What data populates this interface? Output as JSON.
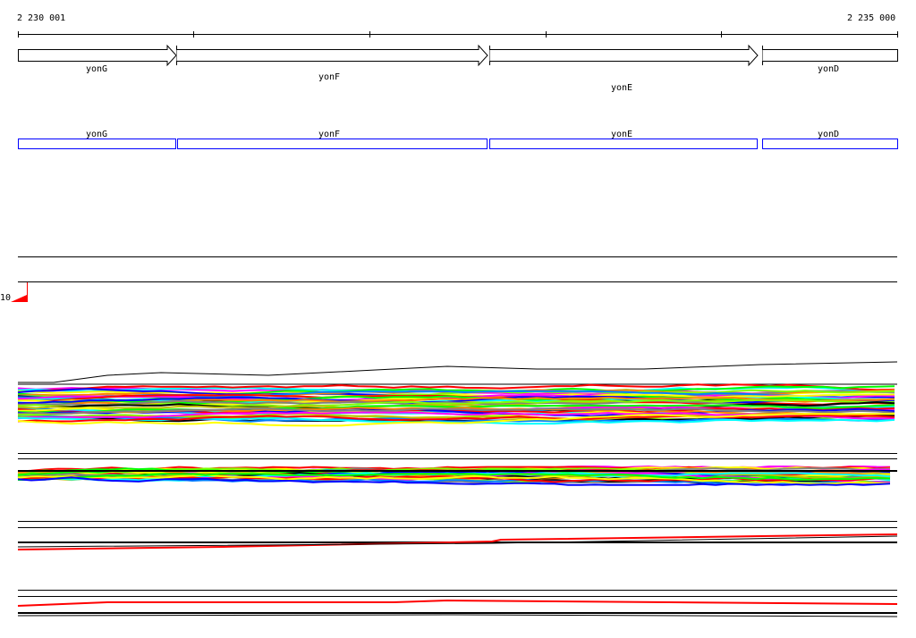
{
  "ruler": {
    "start_label": "2 230 001",
    "end_label": "2 235 000"
  },
  "genes": [
    {
      "name": "yonG"
    },
    {
      "name": "yonF"
    },
    {
      "name": "yonE"
    },
    {
      "name": "yonD"
    }
  ],
  "cds_track": [
    {
      "name": "yonG"
    },
    {
      "name": "yonF"
    },
    {
      "name": "yonE"
    },
    {
      "name": "yonD"
    }
  ],
  "scale": {
    "max_label": "10"
  },
  "colors": {
    "cds": "#0000ff",
    "scale": "#ff0000",
    "series": [
      "#ff00ff",
      "#00ffff",
      "#ff0000",
      "#ffff00",
      "#00ff00",
      "#0000ff",
      "#ff8000",
      "#808080",
      "#80ff00",
      "#000000",
      "#0080ff",
      "#c0c000"
    ]
  }
}
